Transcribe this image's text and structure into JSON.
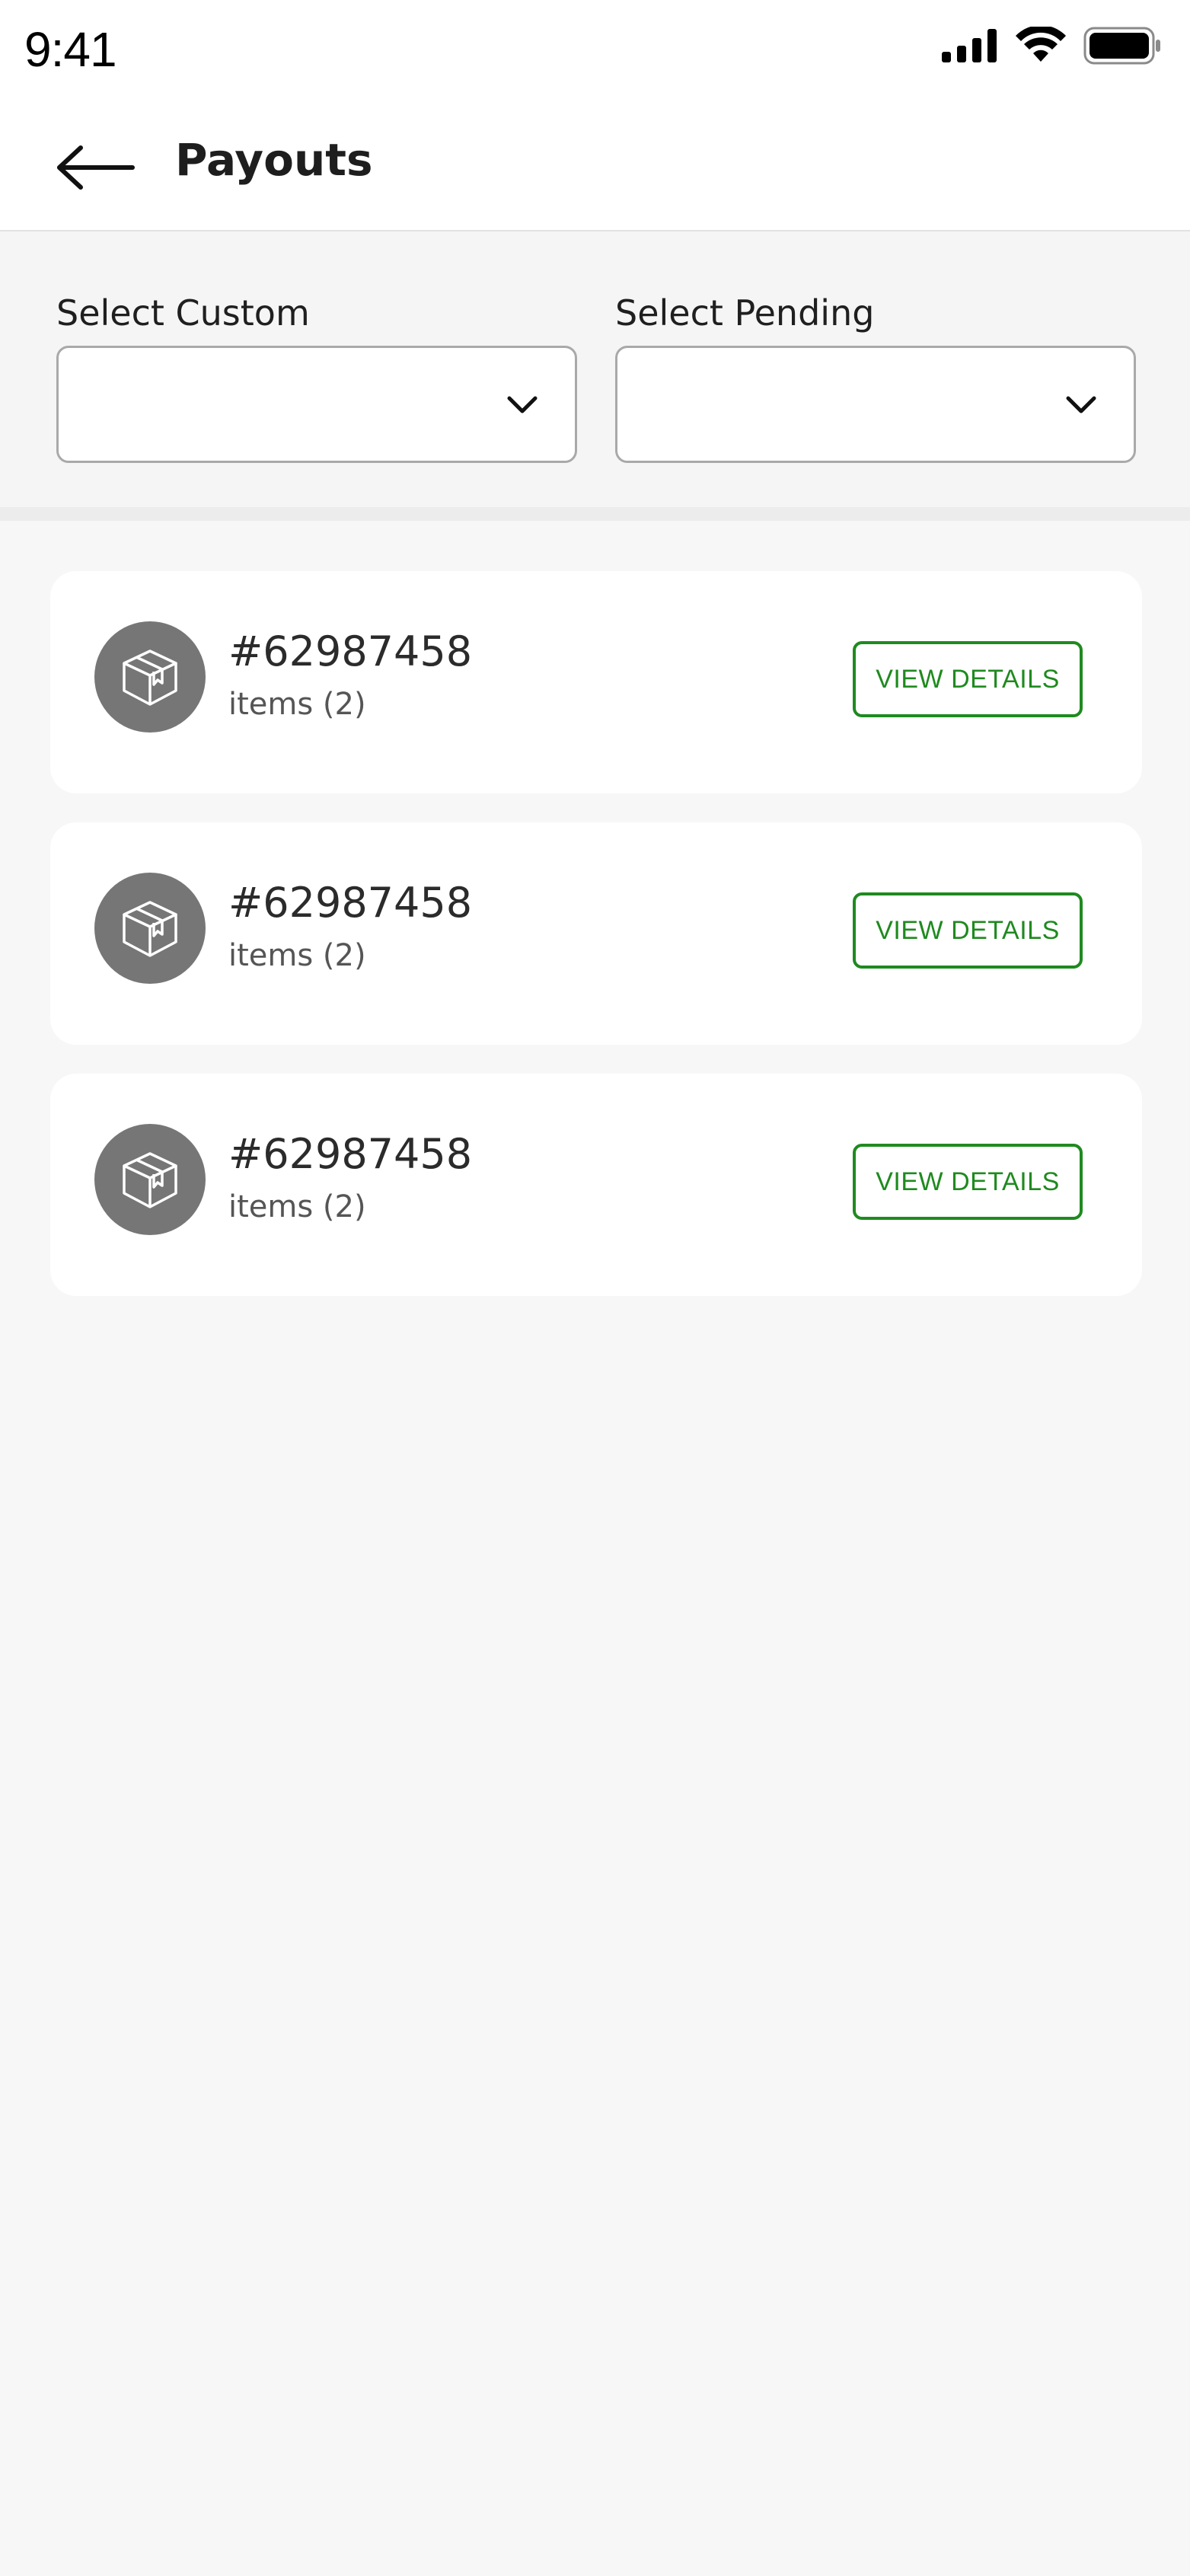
{
  "status_bar": {
    "time": "9:41"
  },
  "header": {
    "title": "Payouts"
  },
  "filters": {
    "custom_label": "Select Custom",
    "custom_value": "",
    "pending_label": "Select Pending",
    "pending_value": ""
  },
  "orders": [
    {
      "id": "#62987458",
      "items": "items (2)",
      "action": "VIEW DETAILS"
    },
    {
      "id": "#62987458",
      "items": "items (2)",
      "action": "VIEW DETAILS"
    },
    {
      "id": "#62987458",
      "items": "items (2)",
      "action": "VIEW DETAILS"
    }
  ],
  "colors": {
    "accent_green": "#1f8a1f",
    "avatar_gray": "#767676",
    "background": "#f7f7f7"
  }
}
